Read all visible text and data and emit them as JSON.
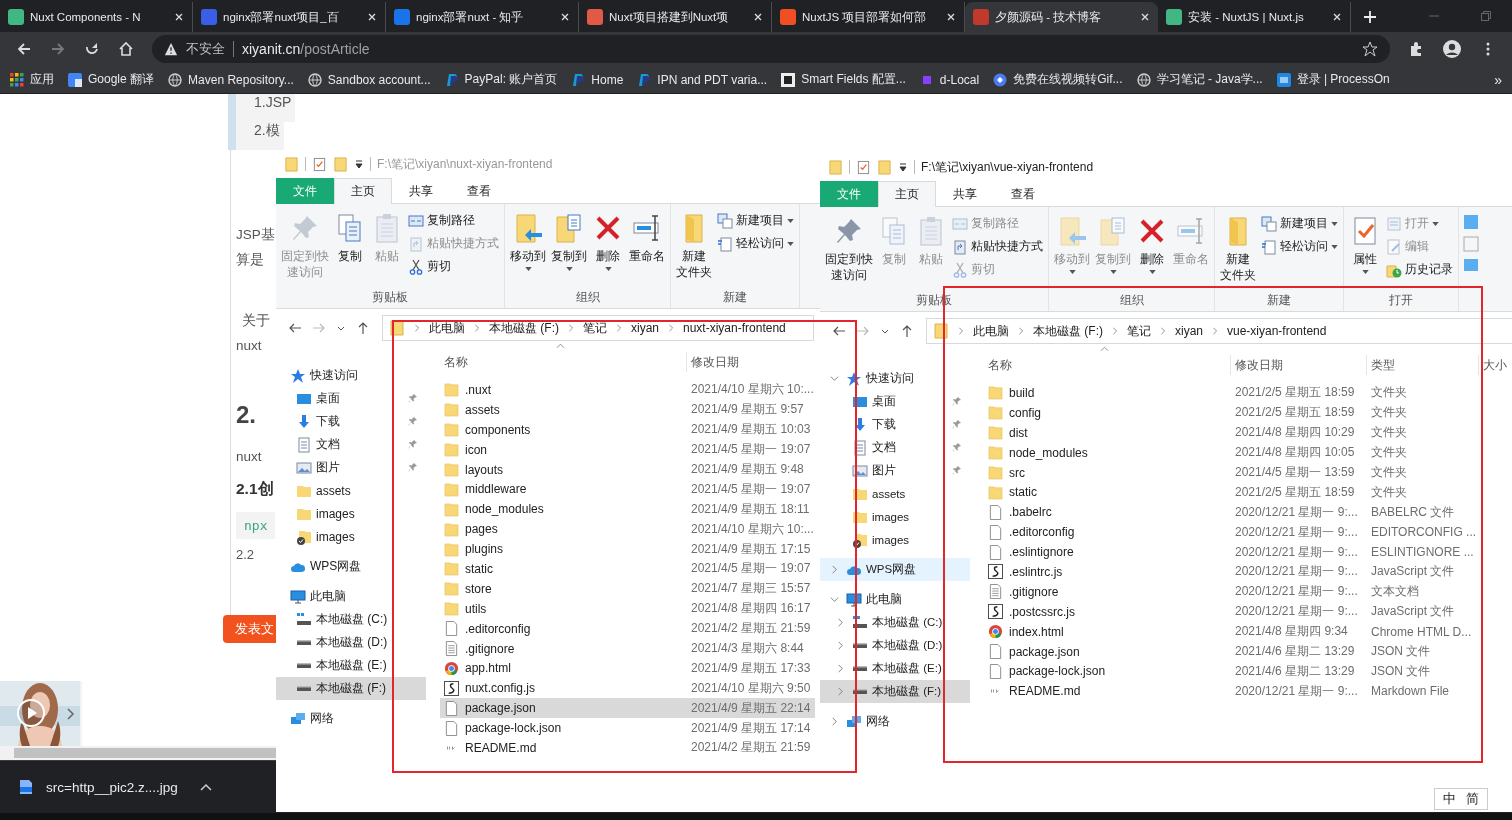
{
  "browser": {
    "tabs": [
      {
        "title": "Nuxt Components - N",
        "color": "#41b883",
        "selected": false
      },
      {
        "title": "nginx部署nuxt项目_百",
        "color": "#3a5ee8",
        "selected": false
      },
      {
        "title": "nginx部署nuxt - 知乎",
        "color": "#1a73e8",
        "selected": false
      },
      {
        "title": "Nuxt项目搭建到Nuxt项",
        "color": "#e05a45",
        "selected": false
      },
      {
        "title": "NuxtJS 项目部署如何部",
        "color": "#f04e23",
        "selected": false
      },
      {
        "title": "夕颜源码 - 技术博客",
        "color": "#c0392b",
        "selected": true
      },
      {
        "title": "安装 - NuxtJS | Nuxt.js",
        "color": "#41b883",
        "selected": false
      }
    ],
    "security": "不安全",
    "host": "xiyanit.cn",
    "path": "/postArticle",
    "bookmarks": [
      {
        "label": "应用",
        "kind": "apps"
      },
      {
        "label": "Google 翻译",
        "kind": "translate"
      },
      {
        "label": "Maven Repository...",
        "kind": "globe"
      },
      {
        "label": "Sandbox account...",
        "kind": "globe"
      },
      {
        "label": "PayPal: 账户首页",
        "kind": "paypal"
      },
      {
        "label": "Home",
        "kind": "paypal"
      },
      {
        "label": "IPN and PDT varia...",
        "kind": "paypal"
      },
      {
        "label": "Smart Fields 配置...",
        "kind": "dark"
      },
      {
        "label": "d-Local",
        "kind": "purple"
      },
      {
        "label": "免费在线视频转Gif...",
        "kind": "blue"
      },
      {
        "label": "学习笔记 - Java学...",
        "kind": "globe"
      },
      {
        "label": "登录 | ProcessOn",
        "kind": "processon"
      }
    ],
    "more": "»"
  },
  "article": [
    {
      "kind": "quote",
      "text": "1.JSP"
    },
    {
      "kind": "quote",
      "text": "2.模"
    },
    {
      "kind": "text",
      "text": "JSP基"
    },
    {
      "kind": "text",
      "text": "算是"
    },
    {
      "kind": "text",
      "text": "关于"
    },
    {
      "kind": "text",
      "text": "nuxt"
    },
    {
      "kind": "heading",
      "text": "2."
    },
    {
      "kind": "text",
      "text": "nuxt"
    },
    {
      "kind": "subheading",
      "text": "2.1创"
    },
    {
      "kind": "code",
      "text": "npx"
    },
    {
      "kind": "small",
      "text": "2.2"
    },
    {
      "kind": "button",
      "text": "发表文"
    }
  ],
  "explorers": [
    {
      "active": false,
      "path": "F:\\笔记\\xiyan\\nuxt-xiyan-frontend",
      "ribbon_tabs": [
        {
          "label": "文件",
          "kind": "file",
          "selected": false
        },
        {
          "label": "主页",
          "kind": "tab",
          "selected": true
        },
        {
          "label": "共享",
          "kind": "tab",
          "selected": false
        },
        {
          "label": "查看",
          "kind": "tab",
          "selected": false
        }
      ],
      "groups": [
        {
          "label": "剪贴板",
          "buttons": [
            {
              "label": "固定到快速访问",
              "kind": "large",
              "disabled": true,
              "dropdown": false
            },
            {
              "label": "复制",
              "kind": "large",
              "disabled": false,
              "dropdown": false
            },
            {
              "label": "粘贴",
              "kind": "large",
              "disabled": true,
              "dropdown": false
            },
            {
              "label": "复制路径",
              "kind": "small",
              "disabled": false,
              "dropdown": false
            },
            {
              "label": "粘贴快捷方式",
              "kind": "small",
              "disabled": true,
              "dropdown": false
            },
            {
              "label": "剪切",
              "kind": "small",
              "disabled": false,
              "dropdown": false
            }
          ]
        },
        {
          "label": "组织",
          "buttons": [
            {
              "label": "移动到",
              "kind": "large",
              "disabled": false,
              "dropdown": true
            },
            {
              "label": "复制到",
              "kind": "large",
              "disabled": false,
              "dropdown": true
            },
            {
              "label": "删除",
              "kind": "large",
              "disabled": false,
              "dropdown": true
            },
            {
              "label": "重命名",
              "kind": "large",
              "disabled": false,
              "dropdown": false
            }
          ]
        },
        {
          "label": "新建",
          "buttons": [
            {
              "label": "新建文件夹",
              "kind": "large",
              "disabled": false,
              "dropdown": false
            },
            {
              "label": "新建项目",
              "kind": "small",
              "disabled": false,
              "dropdown": true
            },
            {
              "label": "轻松访问",
              "kind": "small",
              "disabled": false,
              "dropdown": true
            }
          ]
        }
      ],
      "breadcrumb": [
        "此电脑",
        "本地磁盘 (F:)",
        "笔记",
        "xiyan",
        "nuxt-xiyan-frontend"
      ],
      "nav": [
        {
          "label": "快速访问",
          "kind": "star",
          "selected": false,
          "hovered": false,
          "children": [
            {
              "label": "桌面",
              "kind": "desktop",
              "pinned": true,
              "selected": false
            },
            {
              "label": "下载",
              "kind": "download",
              "pinned": true,
              "selected": false
            },
            {
              "label": "文档",
              "kind": "document",
              "pinned": true,
              "selected": false
            },
            {
              "label": "图片",
              "kind": "pictures",
              "pinned": true,
              "selected": false
            },
            {
              "label": "assets",
              "kind": "folder",
              "pinned": false,
              "selected": false
            },
            {
              "label": "images",
              "kind": "folder",
              "pinned": false,
              "selected": false
            },
            {
              "label": "images",
              "kind": "synced",
              "pinned": false,
              "selected": false
            }
          ]
        },
        {
          "label": "WPS网盘",
          "kind": "cloud",
          "selected": false,
          "hovered": false
        },
        {
          "label": "此电脑",
          "kind": "computer",
          "selected": false,
          "hovered": false,
          "children": [
            {
              "label": "本地磁盘 (C:)",
              "kind": "system-drive",
              "selected": false
            },
            {
              "label": "本地磁盘 (D:)",
              "kind": "drive",
              "selected": false
            },
            {
              "label": "本地磁盘 (E:)",
              "kind": "drive",
              "selected": false
            },
            {
              "label": "本地磁盘 (F:)",
              "kind": "drive",
              "selected": true
            }
          ]
        },
        {
          "label": "网络",
          "kind": "network",
          "selected": false,
          "hovered": false
        }
      ],
      "columns": [
        "名称",
        "修改日期"
      ],
      "rows": [
        {
          "name": ".nuxt",
          "kind": "folder",
          "date": "2021/4/10 星期六 10:...",
          "selected": false
        },
        {
          "name": "assets",
          "kind": "folder",
          "date": "2021/4/9 星期五 9:57",
          "selected": false
        },
        {
          "name": "components",
          "kind": "folder",
          "date": "2021/4/9 星期五 10:03",
          "selected": false
        },
        {
          "name": "icon",
          "kind": "folder",
          "date": "2021/4/5 星期一 19:07",
          "selected": false
        },
        {
          "name": "layouts",
          "kind": "folder",
          "date": "2021/4/9 星期五 9:48",
          "selected": false
        },
        {
          "name": "middleware",
          "kind": "folder",
          "date": "2021/4/5 星期一 19:07",
          "selected": false
        },
        {
          "name": "node_modules",
          "kind": "folder",
          "date": "2021/4/9 星期五 18:11",
          "selected": false
        },
        {
          "name": "pages",
          "kind": "folder",
          "date": "2021/4/10 星期六 10:...",
          "selected": false
        },
        {
          "name": "plugins",
          "kind": "folder",
          "date": "2021/4/9 星期五 17:15",
          "selected": false
        },
        {
          "name": "static",
          "kind": "folder",
          "date": "2021/4/5 星期一 19:07",
          "selected": false
        },
        {
          "name": "store",
          "kind": "folder",
          "date": "2021/4/7 星期三 15:57",
          "selected": false
        },
        {
          "name": "utils",
          "kind": "folder",
          "date": "2021/4/8 星期四 16:17",
          "selected": false
        },
        {
          "name": ".editorconfig",
          "kind": "file",
          "date": "2021/4/2 星期五 21:59",
          "selected": false
        },
        {
          "name": ".gitignore",
          "kind": "text",
          "date": "2021/4/3 星期六 8:44",
          "selected": false
        },
        {
          "name": "app.html",
          "kind": "chrome",
          "date": "2021/4/9 星期五 17:33",
          "selected": false
        },
        {
          "name": "nuxt.config.js",
          "kind": "script",
          "date": "2021/4/10 星期六 9:50",
          "selected": false
        },
        {
          "name": "package.json",
          "kind": "file",
          "date": "2021/4/9 星期五 22:14",
          "selected": true
        },
        {
          "name": "package-lock.json",
          "kind": "file",
          "date": "2021/4/9 星期五 17:14",
          "selected": false
        },
        {
          "name": "README.md",
          "kind": "markdown",
          "date": "2021/4/2 星期五 21:59",
          "selected": false
        }
      ]
    },
    {
      "active": true,
      "path": "F:\\笔记\\xiyan\\vue-xiyan-frontend",
      "ribbon_tabs": [
        {
          "label": "文件",
          "kind": "file",
          "selected": false
        },
        {
          "label": "主页",
          "kind": "tab",
          "selected": true
        },
        {
          "label": "共享",
          "kind": "tab",
          "selected": false
        },
        {
          "label": "查看",
          "kind": "tab",
          "selected": false
        }
      ],
      "groups": [
        {
          "label": "剪贴板",
          "buttons": [
            {
              "label": "固定到快速访问",
              "kind": "large",
              "disabled": false,
              "dropdown": false
            },
            {
              "label": "复制",
              "kind": "large",
              "disabled": true,
              "dropdown": false
            },
            {
              "label": "粘贴",
              "kind": "large",
              "disabled": true,
              "dropdown": false
            },
            {
              "label": "复制路径",
              "kind": "small",
              "disabled": true,
              "dropdown": false
            },
            {
              "label": "粘贴快捷方式",
              "kind": "small",
              "disabled": false,
              "dropdown": false
            },
            {
              "label": "剪切",
              "kind": "small",
              "disabled": true,
              "dropdown": false
            }
          ]
        },
        {
          "label": "组织",
          "buttons": [
            {
              "label": "移动到",
              "kind": "large",
              "disabled": true,
              "dropdown": true
            },
            {
              "label": "复制到",
              "kind": "large",
              "disabled": true,
              "dropdown": true
            },
            {
              "label": "删除",
              "kind": "large",
              "disabled": false,
              "dropdown": true
            },
            {
              "label": "重命名",
              "kind": "large",
              "disabled": true,
              "dropdown": false
            }
          ]
        },
        {
          "label": "新建",
          "buttons": [
            {
              "label": "新建文件夹",
              "kind": "large",
              "disabled": false,
              "dropdown": false
            },
            {
              "label": "新建项目",
              "kind": "small",
              "disabled": false,
              "dropdown": true
            },
            {
              "label": "轻松访问",
              "kind": "small",
              "disabled": false,
              "dropdown": true
            }
          ]
        },
        {
          "label": "打开",
          "buttons": [
            {
              "label": "属性",
              "kind": "large",
              "disabled": false,
              "dropdown": true
            },
            {
              "label": "打开",
              "kind": "small",
              "disabled": true,
              "dropdown": true
            },
            {
              "label": "编辑",
              "kind": "small",
              "disabled": true,
              "dropdown": false
            },
            {
              "label": "历史记录",
              "kind": "small",
              "disabled": false,
              "dropdown": false
            }
          ]
        }
      ],
      "breadcrumb": [
        "此电脑",
        "本地磁盘 (F:)",
        "笔记",
        "xiyan",
        "vue-xiyan-frontend"
      ],
      "nav": [
        {
          "label": "快速访问",
          "kind": "star",
          "expanded": true,
          "selected": false,
          "hovered": false,
          "children": [
            {
              "label": "桌面",
              "kind": "desktop",
              "pinned": true,
              "selected": false
            },
            {
              "label": "下载",
              "kind": "download",
              "pinned": true,
              "selected": false
            },
            {
              "label": "文档",
              "kind": "document",
              "pinned": true,
              "selected": false
            },
            {
              "label": "图片",
              "kind": "pictures",
              "pinned": true,
              "selected": false
            },
            {
              "label": "assets",
              "kind": "folder",
              "pinned": false,
              "selected": false
            },
            {
              "label": "images",
              "kind": "folder",
              "pinned": false,
              "selected": false
            },
            {
              "label": "images",
              "kind": "synced",
              "pinned": false,
              "selected": false
            }
          ]
        },
        {
          "label": "WPS网盘",
          "kind": "cloud",
          "expanded": false,
          "selected": false,
          "hovered": true
        },
        {
          "label": "此电脑",
          "kind": "computer",
          "expanded": true,
          "selected": false,
          "hovered": false,
          "children": [
            {
              "label": "本地磁盘 (C:)",
              "kind": "system-drive",
              "expanded": false,
              "selected": false
            },
            {
              "label": "本地磁盘 (D:)",
              "kind": "drive",
              "expanded": false,
              "selected": false
            },
            {
              "label": "本地磁盘 (E:)",
              "kind": "drive",
              "expanded": false,
              "selected": false
            },
            {
              "label": "本地磁盘 (F:)",
              "kind": "drive",
              "expanded": false,
              "selected": true
            }
          ]
        },
        {
          "label": "网络",
          "kind": "network",
          "expanded": false,
          "selected": false,
          "hovered": false
        }
      ],
      "columns": [
        "名称",
        "修改日期",
        "类型",
        "大小"
      ],
      "rows": [
        {
          "name": "build",
          "kind": "folder",
          "date": "2021/2/5 星期五 18:59",
          "type": "文件夹",
          "selected": false
        },
        {
          "name": "config",
          "kind": "folder",
          "date": "2021/2/5 星期五 18:59",
          "type": "文件夹",
          "selected": false
        },
        {
          "name": "dist",
          "kind": "folder",
          "date": "2021/4/8 星期四 10:29",
          "type": "文件夹",
          "selected": false
        },
        {
          "name": "node_modules",
          "kind": "folder",
          "date": "2021/4/8 星期四 10:05",
          "type": "文件夹",
          "selected": false
        },
        {
          "name": "src",
          "kind": "folder",
          "date": "2021/4/5 星期一 13:59",
          "type": "文件夹",
          "selected": false
        },
        {
          "name": "static",
          "kind": "folder",
          "date": "2021/2/5 星期五 18:59",
          "type": "文件夹",
          "selected": false
        },
        {
          "name": ".babelrc",
          "kind": "file",
          "date": "2020/12/21 星期一 9:...",
          "type": "BABELRC 文件",
          "selected": false
        },
        {
          "name": ".editorconfig",
          "kind": "file",
          "date": "2020/12/21 星期一 9:...",
          "type": "EDITORCONFIG ...",
          "selected": false
        },
        {
          "name": ".eslintignore",
          "kind": "file",
          "date": "2020/12/21 星期一 9:...",
          "type": "ESLINTIGNORE ...",
          "selected": false
        },
        {
          "name": ".eslintrc.js",
          "kind": "script",
          "date": "2020/12/21 星期一 9:...",
          "type": "JavaScript 文件",
          "selected": false
        },
        {
          "name": ".gitignore",
          "kind": "text",
          "date": "2020/12/21 星期一 9:...",
          "type": "文本文档",
          "selected": false
        },
        {
          "name": ".postcssrc.js",
          "kind": "script",
          "date": "2020/12/21 星期一 9:...",
          "type": "JavaScript 文件",
          "selected": false
        },
        {
          "name": "index.html",
          "kind": "chrome",
          "date": "2021/4/8 星期四 9:34",
          "type": "Chrome HTML D...",
          "selected": false
        },
        {
          "name": "package.json",
          "kind": "file",
          "date": "2021/4/6 星期二 13:29",
          "type": "JSON 文件",
          "selected": false
        },
        {
          "name": "package-lock.json",
          "kind": "file",
          "date": "2021/4/6 星期二 13:29",
          "type": "JSON 文件",
          "selected": false
        },
        {
          "name": "README.md",
          "kind": "markdown",
          "date": "2020/12/21 星期一 9:...",
          "type": "Markdown File",
          "selected": false
        }
      ]
    }
  ],
  "annotations": [
    {
      "kind": "frame"
    },
    {
      "kind": "frame"
    }
  ],
  "downloads": [
    {
      "name": "src=http__pic2.z....jpg"
    }
  ],
  "ime": [
    "中",
    "简"
  ]
}
